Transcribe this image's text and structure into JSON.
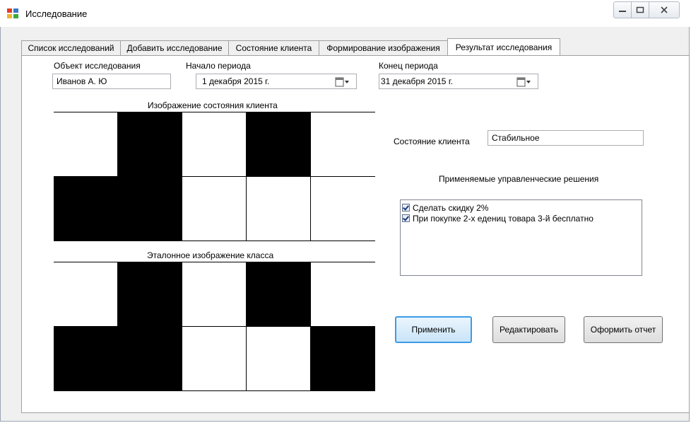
{
  "window": {
    "title": "Исследование",
    "controls": [
      "minimize-icon",
      "maximize-icon",
      "close-icon"
    ]
  },
  "tabs": [
    {
      "label": "Список исследований",
      "active": false
    },
    {
      "label": "Добавить исследование",
      "active": false
    },
    {
      "label": "Состояние клиента",
      "active": false
    },
    {
      "label": "Формирование изображения",
      "active": false
    },
    {
      "label": "Результат исследования",
      "active": true
    }
  ],
  "form": {
    "object_label": "Объект исследования",
    "object_value": "Иванов А. Ю",
    "start_label": "Начало периода",
    "start_value": "1 декабря  2015 г.",
    "end_label": "Конец периода",
    "end_value": "31 декабря  2015 г."
  },
  "images": {
    "client_title": "Изображение состояния клиента",
    "client_grid": [
      [
        0,
        1,
        0,
        1,
        0
      ],
      [
        1,
        1,
        0,
        0,
        0
      ]
    ],
    "reference_title": "Эталонное изображение класса",
    "reference_grid": [
      [
        0,
        1,
        0,
        1,
        0
      ],
      [
        1,
        1,
        0,
        0,
        1
      ]
    ]
  },
  "state": {
    "label": "Состояние клиента",
    "value": "Стабильное"
  },
  "decisions": {
    "title": "Применяемые управленческие решения",
    "items": [
      {
        "label": "Сделать скидку 2%",
        "checked": true
      },
      {
        "label": "При покупке  2-х едениц товара 3-й бесплатно",
        "checked": true
      }
    ]
  },
  "buttons": {
    "apply": "Применить",
    "edit": "Редактировать",
    "report": "Оформить отчет"
  }
}
